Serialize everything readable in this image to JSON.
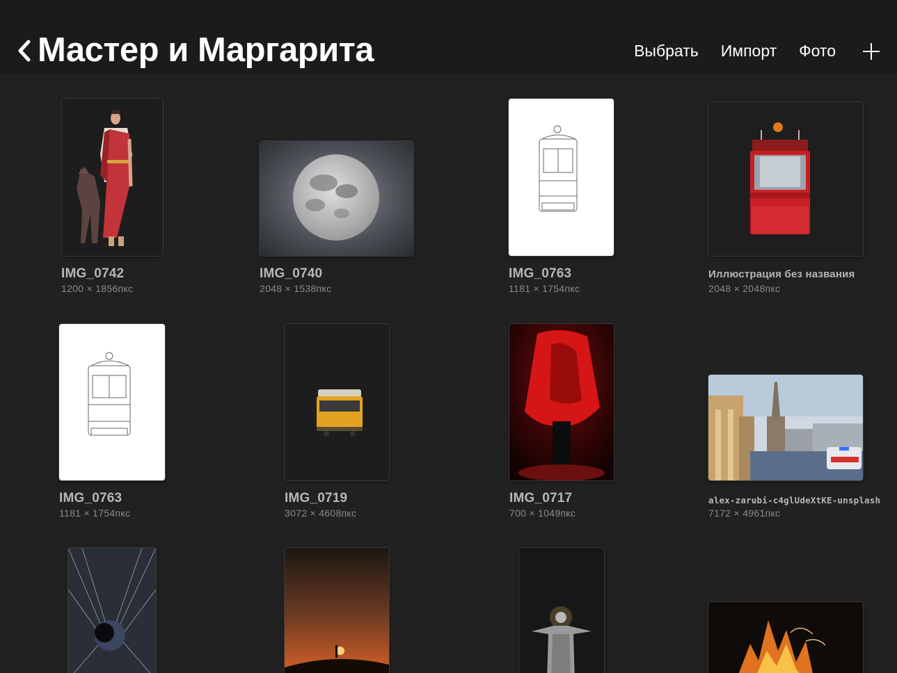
{
  "header": {
    "back_icon": "chevron-left-icon",
    "title": "Мастер и Маргарита",
    "actions": {
      "select": "Выбрать",
      "import": "Импорт",
      "photo": "Фото"
    },
    "add_icon": "plus-icon"
  },
  "gallery": [
    {
      "name": "IMG_0742",
      "dims": "1200 × 1856пкс"
    },
    {
      "name": "IMG_0740",
      "dims": "2048 × 1538пкс"
    },
    {
      "name": "IMG_0763",
      "dims": "1181 × 1754пкс"
    },
    {
      "name": "Иллюстрация без названия",
      "dims": "2048 × 2048пкс"
    },
    {
      "name": "IMG_0763",
      "dims": "1181 × 1754пкс"
    },
    {
      "name": "IMG_0719",
      "dims": "3072 × 4608пкс"
    },
    {
      "name": "IMG_0717",
      "dims": "700 × 1049пкс"
    },
    {
      "name": "alex-zarubi-c4glUdeXtKE-unsplash",
      "dims": "7172 × 4961пкс"
    },
    {
      "name": "",
      "dims": ""
    },
    {
      "name": "",
      "dims": ""
    },
    {
      "name": "",
      "dims": ""
    },
    {
      "name": "",
      "dims": ""
    }
  ],
  "colors": {
    "background": "#212121",
    "header": "#1b1b1b",
    "caption": "#b7b7b7",
    "caption_dims": "#8a8a8a"
  }
}
